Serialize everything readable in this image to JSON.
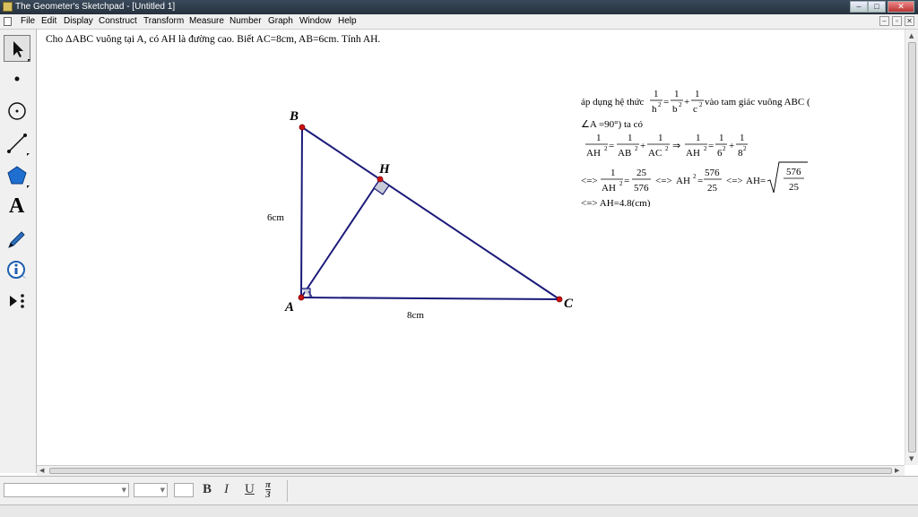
{
  "window": {
    "title": "The Geometer's Sketchpad - [Untitled 1]",
    "buttons": {
      "minimize": "–",
      "maximize": "□",
      "close": "✕"
    }
  },
  "menubar": {
    "items": [
      "File",
      "Edit",
      "Display",
      "Construct",
      "Transform",
      "Measure",
      "Number",
      "Graph",
      "Window",
      "Help"
    ],
    "mdi": {
      "minimize": "–",
      "restore": "▫",
      "close": "✕"
    }
  },
  "toolbox": {
    "tools": [
      "arrow-tool",
      "point-tool",
      "compass-tool",
      "straightedge-tool",
      "polygon-tool",
      "text-tool",
      "marker-tool",
      "information-tool",
      "custom-tool"
    ],
    "text_tool_glyph": "A"
  },
  "problem": {
    "text": "Cho  ΔABC  vuông tại A, có AH là đường cao. Biết AC=8cm, AB=6cm. Tính AH."
  },
  "figure": {
    "labels": {
      "A": "A",
      "B": "B",
      "C": "C",
      "H": "H"
    },
    "side_ab": "6cm",
    "side_ac": "8cm",
    "line_color": "#1a1a7a",
    "point_color": "#cc1111"
  },
  "solution": {
    "l1_pre": "áp dụng hệ thức",
    "l1_post": "vào tam giác vuông ABC (",
    "l2": "∠A =90°) ta có",
    "one": "1",
    "h": "h",
    "b": "b",
    "c": "c",
    "AH": "AH",
    "AB": "AB",
    "AC": "AC",
    "sq": "2",
    "six": "6",
    "eight": "8",
    "eq": "=",
    "plus": "+",
    "implies": "⇒",
    "iff": "<=>",
    "n25": "25",
    "n576": "576",
    "ah2_eq": "AH",
    "ah_eq": "AH=",
    "result": "<=> AH=4.8(cm)"
  },
  "formatbar": {
    "bold": "B",
    "italic": "I",
    "underline": "U",
    "symbol_top": "π",
    "symbol_bottom": "3"
  }
}
